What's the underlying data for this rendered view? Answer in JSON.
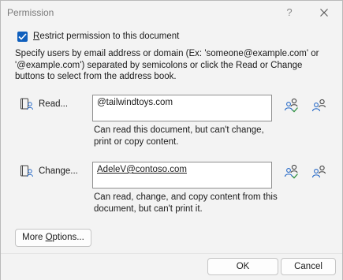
{
  "window": {
    "title": "Permission",
    "help_label": "?"
  },
  "restrict": {
    "checked": true,
    "label_prefix": "R",
    "label_rest": "estrict permission to this document"
  },
  "instructions": "Specify users by email address or domain (Ex: 'someone@example.com' or '@example.com') separated by semicolons or click the Read or Change buttons to select from the address book.",
  "read": {
    "button_label": "Read...",
    "value": "@tailwindtoys.com",
    "description": "Can read this document, but can't change, print or copy content."
  },
  "change": {
    "button_label": "Change...",
    "value": "AdeleV@contoso.com",
    "description": "Can read, change, and copy content from this document, but can't print it."
  },
  "more_options": {
    "label_prefix": "More ",
    "label_underlined": "O",
    "label_rest": "ptions..."
  },
  "footer": {
    "ok_label": "OK",
    "cancel_label": "Cancel"
  },
  "colors": {
    "accent": "#0f5fbd",
    "icon_blue": "#2a6cc8",
    "icon_green": "#2e8f3e"
  },
  "icons": {
    "book": "address-book-icon",
    "check_names": "check-names-icon",
    "add_people": "add-people-icon"
  }
}
